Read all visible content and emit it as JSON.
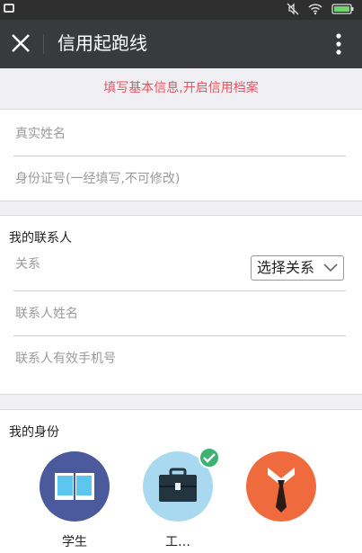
{
  "app": {
    "title": "信用起跑线"
  },
  "notice": "填写基本信息,开启信用档案",
  "basic_info": {
    "name_placeholder": "真实姓名",
    "id_placeholder": "身份证号(一经填写,不可修改)"
  },
  "contact": {
    "section_title": "我的联系人",
    "relation_label": "关系",
    "relation_select": "选择关系",
    "contact_name_placeholder": "联系人姓名",
    "contact_phone_placeholder": "联系人有效手机号"
  },
  "identity": {
    "section_title": "我的身份",
    "options": [
      {
        "label": "学生",
        "icon": "book-icon",
        "color": "#4a5a9c",
        "selected": false
      },
      {
        "label": "工…",
        "icon": "briefcase-icon",
        "color": "#a9d9f0",
        "selected": true
      },
      {
        "label": "",
        "icon": "shirt-tie-icon",
        "color": "#ef6a3c",
        "selected": false
      }
    ]
  },
  "colors": {
    "title_bar": "#393a3e",
    "notice_text": "#e8545c",
    "check": "#3cb371"
  }
}
